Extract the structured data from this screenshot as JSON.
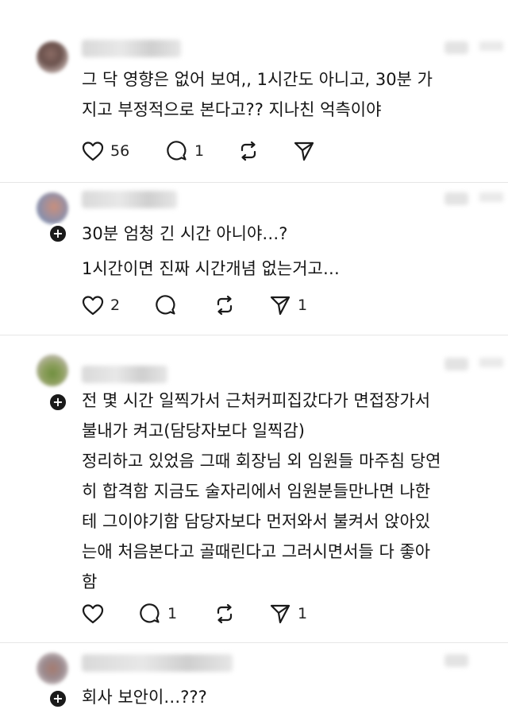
{
  "posts": [
    {
      "lines": [
        "그 닥 영향은 없어 보여,, 1시간도 아니고, 30분 가",
        "지고 부정적으로 본다고?? 지나친 억측이야"
      ],
      "likes": "56",
      "replies": "1",
      "reposts": "",
      "shares": ""
    },
    {
      "lines": [
        "30분 엄청 긴 시간 아니야…?",
        "1시간이면 진짜 시간개념 없는거고…"
      ],
      "likes": "2",
      "replies": "",
      "reposts": "",
      "shares": "1"
    },
    {
      "lines": [
        "전 몇 시간 일찍가서 근처커피집갔다가 면접장가서",
        "불내가 켜고(담당자보다 일찍감)",
        "정리하고 있었음 그때 회장님 외 임원들 마주침 당연",
        "히 합격함 지금도 술자리에서 임원분들만나면 나한",
        "테 그이야기함 담당자보다 먼저와서 불켜서 앉아있",
        "는애 처음본다고 골때린다고 그러시면서들 다 좋아",
        "함"
      ],
      "likes": "",
      "replies": "1",
      "reposts": "",
      "shares": "1"
    },
    {
      "lines": [
        "회사 보안이…???"
      ]
    }
  ],
  "icons": {
    "like": "heart-icon",
    "reply": "comment-icon",
    "repost": "repost-icon",
    "share": "send-icon",
    "follow": "plus-icon"
  },
  "colors": {
    "text": "#151515",
    "icon": "#1a1a1a",
    "divider": "#e6e6e6",
    "background": "#ffffff"
  }
}
